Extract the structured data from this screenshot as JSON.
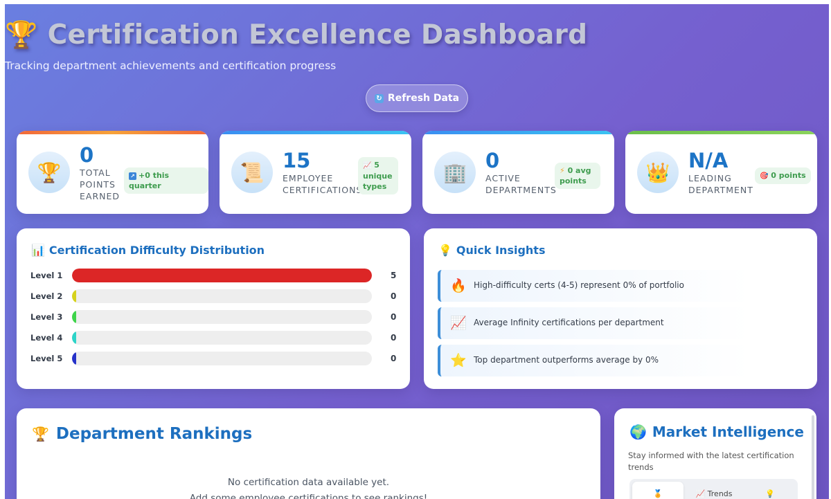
{
  "header": {
    "trophy_icon": "🏆",
    "title": "Certification Excellence Dashboard",
    "subtitle": "Tracking department achievements and certification progress",
    "refresh_icon": "🔄",
    "refresh_label": "Refresh Data"
  },
  "stats": [
    {
      "icon": "🏆",
      "value": "0",
      "label_lines": [
        "TOTAL",
        "POINTS",
        "EARNED"
      ],
      "badge_icon": "↗",
      "badge": "+0 this quarter",
      "accent": "#f2683a"
    },
    {
      "icon": "📜",
      "value": "15",
      "label_lines": [
        "EMPLOYEE",
        "CERTIFICATIONS"
      ],
      "badge_icon": "📈",
      "badge_lines": [
        "5",
        "unique",
        "types"
      ],
      "accent": "#3aa0f2"
    },
    {
      "icon": "🏢",
      "value": "0",
      "label_lines": [
        "ACTIVE",
        "DEPARTMENTS"
      ],
      "badge_icon": "⚡",
      "badge_lines": [
        "0 avg",
        "points"
      ],
      "accent": "#3aa0f2"
    },
    {
      "icon": "👑",
      "value": "N/A",
      "label_lines": [
        "LEADING",
        "DEPARTMENT"
      ],
      "badge_icon": "🎯",
      "badge": "0 points",
      "accent": "#6cbf4a"
    }
  ],
  "difficulty": {
    "icon": "📊",
    "title": "Certification Difficulty Distribution",
    "levels": [
      {
        "label": "Level 1",
        "count": "5",
        "fraction": 1.0,
        "color": "#dc2626"
      },
      {
        "label": "Level 2",
        "count": "0",
        "fraction": 0.0,
        "color": "#d6d21c"
      },
      {
        "label": "Level 3",
        "count": "0",
        "fraction": 0.0,
        "color": "#3ed44a"
      },
      {
        "label": "Level 4",
        "count": "0",
        "fraction": 0.0,
        "color": "#2dd4c8"
      },
      {
        "label": "Level 5",
        "count": "0",
        "fraction": 0.0,
        "color": "#2632c9"
      }
    ]
  },
  "insights": {
    "icon": "💡",
    "title": "Quick Insights",
    "items": [
      {
        "icon": "🔥",
        "text": "High-difficulty certs (4-5) represent 0% of portfolio"
      },
      {
        "icon": "📈",
        "text": "Average Infinity certifications per department"
      },
      {
        "icon": "⭐",
        "text": "Top department outperforms average by 0%"
      }
    ]
  },
  "rankings": {
    "icon": "🏆",
    "title": "Department Rankings",
    "empty_line1": "No certification data available yet.",
    "empty_line2": "Add some employee certifications to see rankings!"
  },
  "market": {
    "icon": "🌍",
    "title": "Market Intelligence",
    "description_lines": [
      "Stay informed with the latest certification",
      "trends"
    ],
    "tabs": [
      {
        "icon": "🏅",
        "label": ""
      },
      {
        "icon": "📈",
        "label": "Trends"
      },
      {
        "icon": "💡",
        "label": ""
      }
    ]
  }
}
